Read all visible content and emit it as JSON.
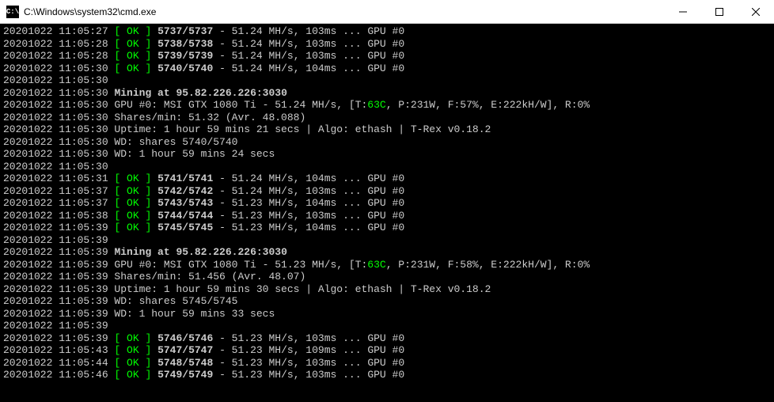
{
  "window": {
    "title": "C:\\Windows\\system32\\cmd.exe",
    "icon_label": "cmd-icon"
  },
  "lines": [
    {
      "ts": "20201022 11:05:27",
      "type": "ok",
      "share": "5737/5737",
      "rate": "51.24 MH/s",
      "latency": "103ms",
      "gpu": "GPU #0"
    },
    {
      "ts": "20201022 11:05:28",
      "type": "ok",
      "share": "5738/5738",
      "rate": "51.24 MH/s",
      "latency": "103ms",
      "gpu": "GPU #0"
    },
    {
      "ts": "20201022 11:05:28",
      "type": "ok",
      "share": "5739/5739",
      "rate": "51.24 MH/s",
      "latency": "103ms",
      "gpu": "GPU #0"
    },
    {
      "ts": "20201022 11:05:30",
      "type": "ok",
      "share": "5740/5740",
      "rate": "51.24 MH/s",
      "latency": "104ms",
      "gpu": "GPU #0"
    },
    {
      "ts": "20201022 11:05:30",
      "type": "blank"
    },
    {
      "ts": "20201022 11:05:30",
      "type": "mining",
      "text": "Mining at 95.82.226.226:3030"
    },
    {
      "ts": "20201022 11:05:30",
      "type": "gpu",
      "prefix": "GPU #0: MSI GTX 1080 Ti - 51.24 MH/s, [T:",
      "temp": "63C",
      "suffix": ", P:231W, F:57%, E:222kH/W], R:0%"
    },
    {
      "ts": "20201022 11:05:30",
      "type": "plain",
      "text": "Shares/min: 51.32 (Avr. 48.088)"
    },
    {
      "ts": "20201022 11:05:30",
      "type": "plain",
      "text": "Uptime: 1 hour 59 mins 21 secs | Algo: ethash | T-Rex v0.18.2"
    },
    {
      "ts": "20201022 11:05:30",
      "type": "plain",
      "text": "WD: shares 5740/5740"
    },
    {
      "ts": "20201022 11:05:30",
      "type": "plain",
      "text": "WD: 1 hour 59 mins 24 secs"
    },
    {
      "ts": "20201022 11:05:30",
      "type": "blank"
    },
    {
      "ts": "20201022 11:05:31",
      "type": "ok",
      "share": "5741/5741",
      "rate": "51.24 MH/s",
      "latency": "104ms",
      "gpu": "GPU #0"
    },
    {
      "ts": "20201022 11:05:37",
      "type": "ok",
      "share": "5742/5742",
      "rate": "51.24 MH/s",
      "latency": "103ms",
      "gpu": "GPU #0"
    },
    {
      "ts": "20201022 11:05:37",
      "type": "ok",
      "share": "5743/5743",
      "rate": "51.23 MH/s",
      "latency": "104ms",
      "gpu": "GPU #0"
    },
    {
      "ts": "20201022 11:05:38",
      "type": "ok",
      "share": "5744/5744",
      "rate": "51.23 MH/s",
      "latency": "103ms",
      "gpu": "GPU #0"
    },
    {
      "ts": "20201022 11:05:39",
      "type": "ok",
      "share": "5745/5745",
      "rate": "51.23 MH/s",
      "latency": "104ms",
      "gpu": "GPU #0"
    },
    {
      "ts": "20201022 11:05:39",
      "type": "blank"
    },
    {
      "ts": "20201022 11:05:39",
      "type": "mining",
      "text": "Mining at 95.82.226.226:3030"
    },
    {
      "ts": "20201022 11:05:39",
      "type": "gpu",
      "prefix": "GPU #0: MSI GTX 1080 Ti - 51.23 MH/s, [T:",
      "temp": "63C",
      "suffix": ", P:231W, F:58%, E:222kH/W], R:0%"
    },
    {
      "ts": "20201022 11:05:39",
      "type": "plain",
      "text": "Shares/min: 51.456 (Avr. 48.07)"
    },
    {
      "ts": "20201022 11:05:39",
      "type": "plain",
      "text": "Uptime: 1 hour 59 mins 30 secs | Algo: ethash | T-Rex v0.18.2"
    },
    {
      "ts": "20201022 11:05:39",
      "type": "plain",
      "text": "WD: shares 5745/5745"
    },
    {
      "ts": "20201022 11:05:39",
      "type": "plain",
      "text": "WD: 1 hour 59 mins 33 secs"
    },
    {
      "ts": "20201022 11:05:39",
      "type": "blank"
    },
    {
      "ts": "20201022 11:05:39",
      "type": "ok",
      "share": "5746/5746",
      "rate": "51.23 MH/s",
      "latency": "103ms",
      "gpu": "GPU #0"
    },
    {
      "ts": "20201022 11:05:43",
      "type": "ok",
      "share": "5747/5747",
      "rate": "51.23 MH/s",
      "latency": "109ms",
      "gpu": "GPU #0"
    },
    {
      "ts": "20201022 11:05:44",
      "type": "ok",
      "share": "5748/5748",
      "rate": "51.23 MH/s",
      "latency": "103ms",
      "gpu": "GPU #0"
    },
    {
      "ts": "20201022 11:05:46",
      "type": "ok",
      "share": "5749/5749",
      "rate": "51.23 MH/s",
      "latency": "103ms",
      "gpu": "GPU #0"
    }
  ]
}
